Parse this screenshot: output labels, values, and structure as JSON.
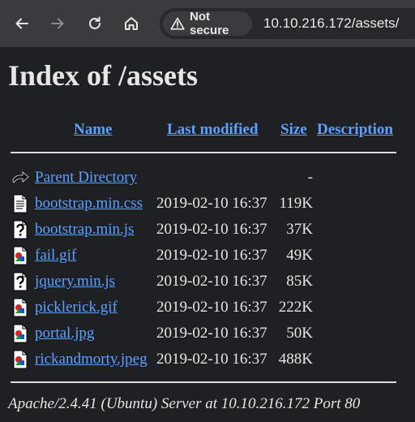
{
  "browser": {
    "security_label": "Not secure",
    "url": "10.10.216.172/assets/",
    "icons": [
      "back-icon",
      "forward-icon",
      "reload-icon",
      "home-icon",
      "warning-icon"
    ]
  },
  "page": {
    "title": "Index of /assets",
    "columns": {
      "name": "Name",
      "last_modified": "Last modified",
      "size": "Size",
      "description": "Description"
    },
    "parent": {
      "name": "Parent Directory",
      "size": "-",
      "icon": "back-folder-icon"
    },
    "files": [
      {
        "name": "bootstrap.min.css",
        "modified": "2019-02-10 16:37",
        "size": "119K",
        "icon": "text-file-icon"
      },
      {
        "name": "bootstrap.min.js",
        "modified": "2019-02-10 16:37",
        "size": "37K",
        "icon": "unknown-file-icon"
      },
      {
        "name": "fail.gif",
        "modified": "2019-02-10 16:37",
        "size": "49K",
        "icon": "image-file-icon"
      },
      {
        "name": "jquery.min.js",
        "modified": "2019-02-10 16:37",
        "size": "85K",
        "icon": "unknown-file-icon"
      },
      {
        "name": "picklerick.gif",
        "modified": "2019-02-10 16:37",
        "size": "222K",
        "icon": "image-file-icon"
      },
      {
        "name": "portal.jpg",
        "modified": "2019-02-10 16:37",
        "size": "50K",
        "icon": "image-file-icon"
      },
      {
        "name": "rickandmorty.jpeg",
        "modified": "2019-02-10 16:37",
        "size": "488K",
        "icon": "image-file-icon"
      }
    ],
    "footer": "Apache/2.4.41 (Ubuntu) Server at 10.10.216.172 Port 80"
  },
  "colors": {
    "page_background": "#1f2023",
    "toolbar_background": "#3a3b3e",
    "link": "#5ea0ff",
    "text": "#e6e6e6"
  }
}
